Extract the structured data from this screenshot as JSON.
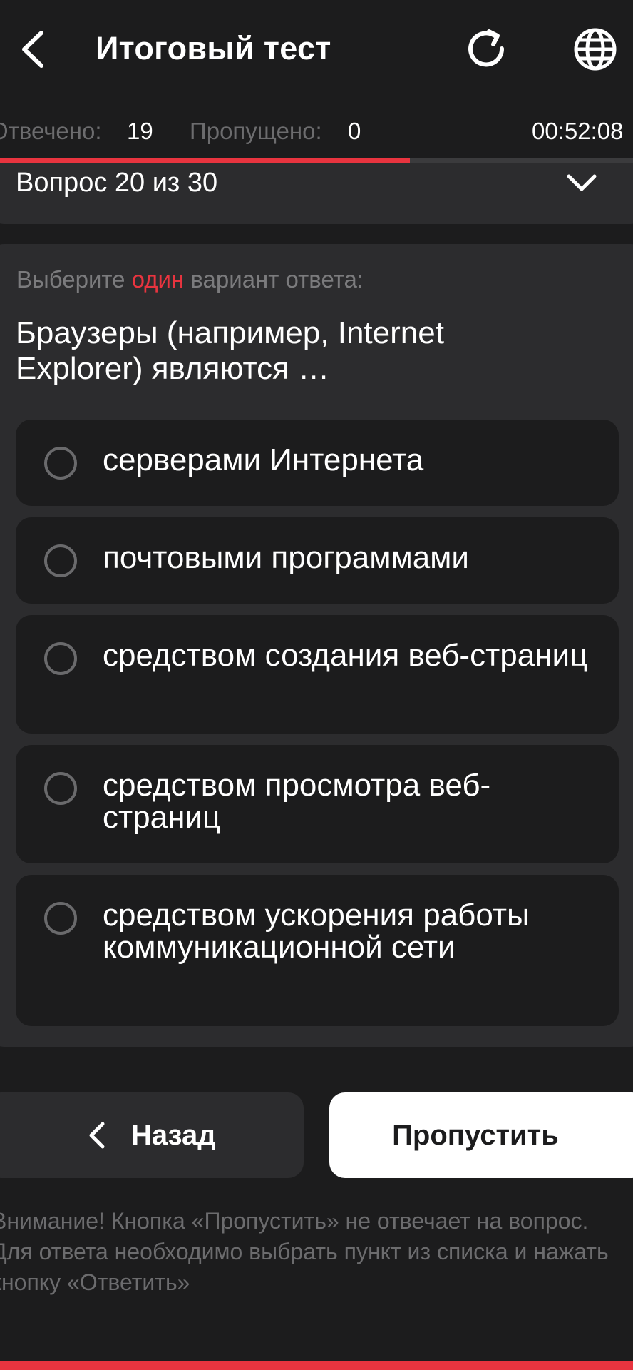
{
  "colors": {
    "background": "#1c1c1d",
    "card": "#2c2c2e",
    "accent": "#e8343f",
    "muted_text": "#6c6c6e",
    "radio_ring": "#6a6a6c",
    "primary_button": "#ffffff"
  },
  "header": {
    "title": "Итоговый тест",
    "back_icon": "chevron-left-icon",
    "refresh_icon": "refresh-icon",
    "language_icon": "globe-icon"
  },
  "stats": {
    "answered_label": "Отвечено:",
    "answered_value": "19",
    "skipped_label": "Пропущено:",
    "skipped_value": "0",
    "timer": "00:52:08"
  },
  "progress": {
    "fraction": 0.647
  },
  "question_selector": {
    "label": "Вопрос 20 из 30",
    "icon": "chevron-down-icon"
  },
  "question": {
    "instruction_prefix": "Выберите ",
    "instruction_accent": "один",
    "instruction_suffix": " вариант ответа:",
    "text": "Браузеры (например, Internet Explorer) являются …",
    "options": [
      {
        "label": "серверами Интернета",
        "selected": false
      },
      {
        "label": "почтовыми программами",
        "selected": false
      },
      {
        "label": "средством создания веб-страниц",
        "selected": false
      },
      {
        "label": "средством просмотра веб-страниц",
        "selected": false
      },
      {
        "label": "средством ускорения работы коммуникационной сети",
        "selected": false
      }
    ]
  },
  "buttons": {
    "back_label": "Назад",
    "skip_label": "Пропустить"
  },
  "notice": "Внимание! Кнопка «Пропустить» не отвечает на вопрос. Для ответа необходимо выбрать пункт из списка и нажать кнопку «Ответить»"
}
